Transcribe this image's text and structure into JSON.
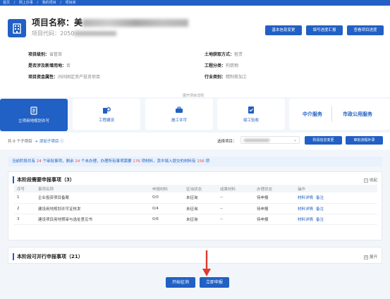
{
  "breadcrumb": [
    "首页",
    "/",
    "网上办事",
    "/",
    "我的项目",
    "/",
    "项目库"
  ],
  "project": {
    "name_label": "项目名称：",
    "name_value": "美",
    "code_label": "项目代码：",
    "code_value": "2050"
  },
  "header_buttons": {
    "change_info": "基本信息变更",
    "fill_progress": "填写进度汇报",
    "view_progress": "查看项目进度"
  },
  "info": {
    "level_key": "项目级别：",
    "level_val": "省管目",
    "land_key": "土地获取方式：",
    "land_val": "租赁",
    "new_land_key": "是否涉及新增用地：",
    "new_land_val": "否",
    "category_key": "工程分类：",
    "category_val": "构筑物",
    "fund_key": "项目资金属性：",
    "fund_val": "间间固定资产投资项目",
    "industry_key": "行业类别：",
    "industry_val": "精制茶加工",
    "expand": "展开项目详情"
  },
  "tabs": {
    "t1": "立项用地规划许可",
    "t2": "工程建设",
    "t3": "施工许可",
    "t4": "竣工验收",
    "svc1": "中介服务",
    "svc2": "市政公用服务"
  },
  "toolbar": {
    "count_text": "共 0 个子项目",
    "add_text": "+ 添加子项目 ⓘ",
    "stage_label": "选择项目：",
    "stage_value": "",
    "chevron": "⌄",
    "btn_stage_info": "阶段信息变更",
    "btn_supplement": "审批流程补录"
  },
  "notice": {
    "p1": "当前阶段共有 ",
    "n1": "24",
    "p2": " 个审批事项，剩余 ",
    "n2": "24",
    "p3": " 个未办理，办理所有事项需要 ",
    "n3": "176",
    "p4": " 项材料，其中填入提交的材料有 ",
    "n4": "156",
    "p5": " 项"
  },
  "panel1": {
    "title": "本阶段需要申报事项（3）",
    "toggle_symbol": "−",
    "toggle": "收起",
    "headers": [
      "序号",
      "事项名称",
      "申报材料",
      "征询状态",
      "成果材料",
      "办理状态",
      "操作"
    ],
    "rows": [
      {
        "no": "1",
        "name": "企业投资项目备案",
        "material": "0/0",
        "consult": "未征询",
        "result": "--",
        "status": "待申报",
        "op1": "材料详情",
        "op2": "备注"
      },
      {
        "no": "2",
        "name": "建设用地规划许可证核发",
        "material": "0/4",
        "consult": "未征询",
        "result": "--",
        "status": "待申报",
        "op1": "材料详情",
        "op2": "备注"
      },
      {
        "no": "3",
        "name": "建设项目用地预审与选址意见书",
        "material": "0/6",
        "consult": "未征询",
        "result": "--",
        "status": "待申报",
        "op1": "材料详情",
        "op2": "备注"
      }
    ]
  },
  "panel2": {
    "title": "本阶段可并行申报事项（21）",
    "toggle_symbol": "+",
    "toggle": "展开"
  },
  "footer": {
    "start_consult": "开始征询",
    "apply_now": "立即申报"
  },
  "colors": {
    "primary": "#2160c4",
    "accent_red": "#e54b4b",
    "annotation_arrow": "#e03a2f"
  }
}
